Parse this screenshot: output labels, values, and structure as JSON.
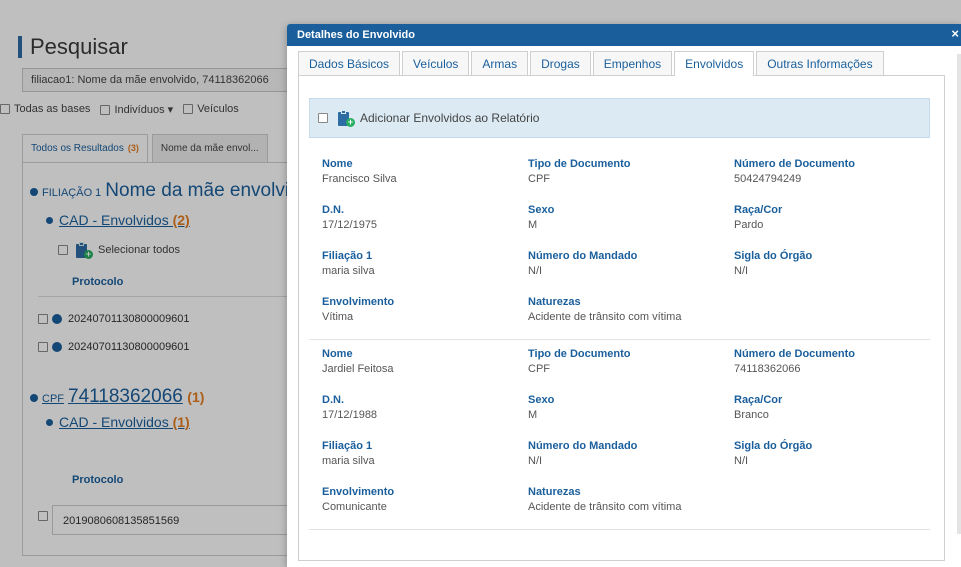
{
  "background": {
    "title": "Pesquisar",
    "search_value": "filiacao1: Nome da mãe envolvido, 74118362066",
    "filters": [
      "Todas as bases",
      "Indivíduos",
      "Veículos"
    ],
    "tabs": [
      {
        "label": "Todos os Resultados",
        "count": "(3)"
      },
      {
        "label": "Nome da mãe envol..."
      }
    ],
    "group1": {
      "prefix": "FILIAÇÃO 1",
      "title": "Nome da mãe envolvi",
      "sub_label": "CAD - Envolvidos",
      "sub_count": "(2)"
    },
    "select_all": "Selecionar todos",
    "protocol_header": "Protocolo",
    "group1_rows": [
      "20240701130800009601",
      "20240701130800009601"
    ],
    "group2": {
      "prefix": "CPF",
      "title": "74118362066",
      "count": "(1)",
      "sub_label": "CAD - Envolvidos",
      "sub_count": "(1)"
    },
    "group2_protocol_header": "Protocolo",
    "group2_row": "2019080608135851569"
  },
  "modal": {
    "title": "Detalhes do Envolvido",
    "close": "×",
    "tabs": [
      "Dados Básicos",
      "Veículos",
      "Armas",
      "Drogas",
      "Empenhos",
      "Envolvidos",
      "Outras Informações"
    ],
    "active_tab": "Envolvidos",
    "add_label": "Adicionar Envolvidos ao Relatório",
    "labels": {
      "nome": "Nome",
      "tipo_doc": "Tipo de Documento",
      "num_doc": "Número de Documento",
      "dn": "D.N.",
      "sexo": "Sexo",
      "raca": "Raça/Cor",
      "filiacao": "Filiação 1",
      "mandado": "Número do Mandado",
      "orgao": "Sigla do Órgão",
      "envolvimento": "Envolvimento",
      "naturezas": "Naturezas"
    },
    "persons": [
      {
        "nome": "Francisco Silva",
        "tipo_doc": "CPF",
        "num_doc": "50424794249",
        "dn": "17/12/1975",
        "sexo": "M",
        "raca": "Pardo",
        "filiacao": "maria silva",
        "mandado": "N/I",
        "orgao": "N/I",
        "envolvimento": "Vítima",
        "naturezas": "Acidente de trânsito com vítima"
      },
      {
        "nome": "Jardiel Feitosa",
        "tipo_doc": "CPF",
        "num_doc": "74118362066",
        "dn": "17/12/1988",
        "sexo": "M",
        "raca": "Branco",
        "filiacao": "maria silva",
        "mandado": "N/I",
        "orgao": "N/I",
        "envolvimento": "Comunicante",
        "naturezas": "Acidente de trânsito com vítima"
      }
    ]
  }
}
